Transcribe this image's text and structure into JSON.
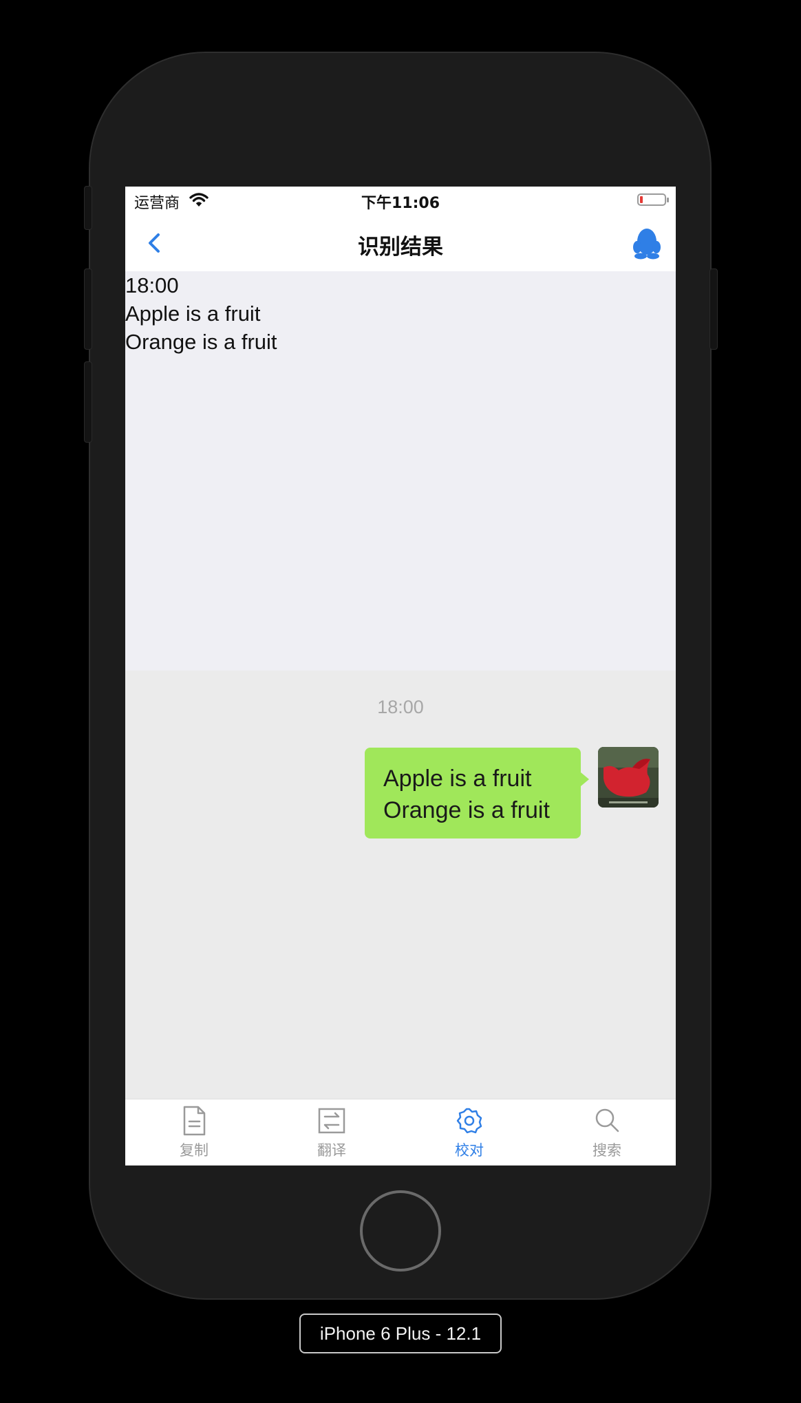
{
  "status_bar": {
    "carrier": "运营商",
    "time": "下午11:06"
  },
  "nav": {
    "title": "识别结果"
  },
  "recognized_text": {
    "lines": [
      "18:00",
      "Apple is a fruit",
      "Orange is a fruit"
    ]
  },
  "chat": {
    "timestamp": "18:00",
    "message_lines": [
      "Apple is a fruit",
      "Orange is a fruit"
    ]
  },
  "tabs": [
    {
      "label": "复制",
      "icon": "document-icon",
      "active": false
    },
    {
      "label": "翻译",
      "icon": "translate-icon",
      "active": false
    },
    {
      "label": "校对",
      "icon": "gear-icon",
      "active": true
    },
    {
      "label": "搜索",
      "icon": "search-icon",
      "active": false
    }
  ],
  "colors": {
    "accent": "#2f7fe6",
    "bubble": "#a0e75a",
    "battery_low": "#e53935"
  },
  "simulator": {
    "device_label": "iPhone 6 Plus - 12.1"
  }
}
